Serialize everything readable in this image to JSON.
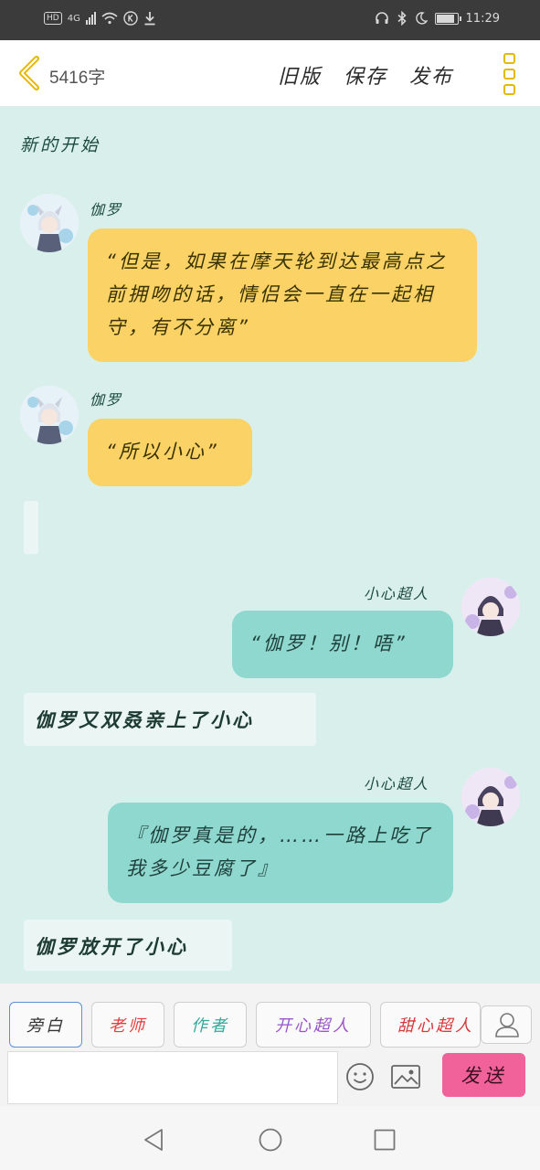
{
  "status_bar": {
    "network": "HD",
    "signal_type": "4G",
    "time": "11:29",
    "battery_level": 0.8
  },
  "header": {
    "word_count": "5416字",
    "actions": [
      "旧版",
      "保存",
      "发布"
    ]
  },
  "chat": {
    "title": "新的开始",
    "messages": [
      {
        "speaker": "伽罗",
        "text": "“但是，如果在摩天轮到达最高点之前拥吻的话，情侣会一直在一起相守，有不分离”"
      },
      {
        "speaker": "伽罗",
        "text": "“所以小心”"
      },
      {
        "speaker": "小心超人",
        "text": "“伽罗！别！唔”"
      },
      {
        "narration": "伽罗又双叒亲上了小心"
      },
      {
        "speaker": "小心超人",
        "text": "『伽罗真是的，……一路上吃了我多少豆腐了』"
      },
      {
        "narration": "伽罗放开了小心"
      }
    ]
  },
  "roles": [
    "旁白",
    "老师",
    "作者",
    "开心超人",
    "甜心超人"
  ],
  "role_colors": {
    "老师": "#e04040",
    "作者": "#35a89a",
    "开心超人": "#9a55c8",
    "甜心超人": "#d43a3a"
  },
  "input": {
    "placeholder": "",
    "send_label": "发送"
  },
  "colors": {
    "yellow_bubble": "#fad266",
    "teal_bubble": "#8ed8cf",
    "send": "#f2629a",
    "background": "#d9efec"
  }
}
